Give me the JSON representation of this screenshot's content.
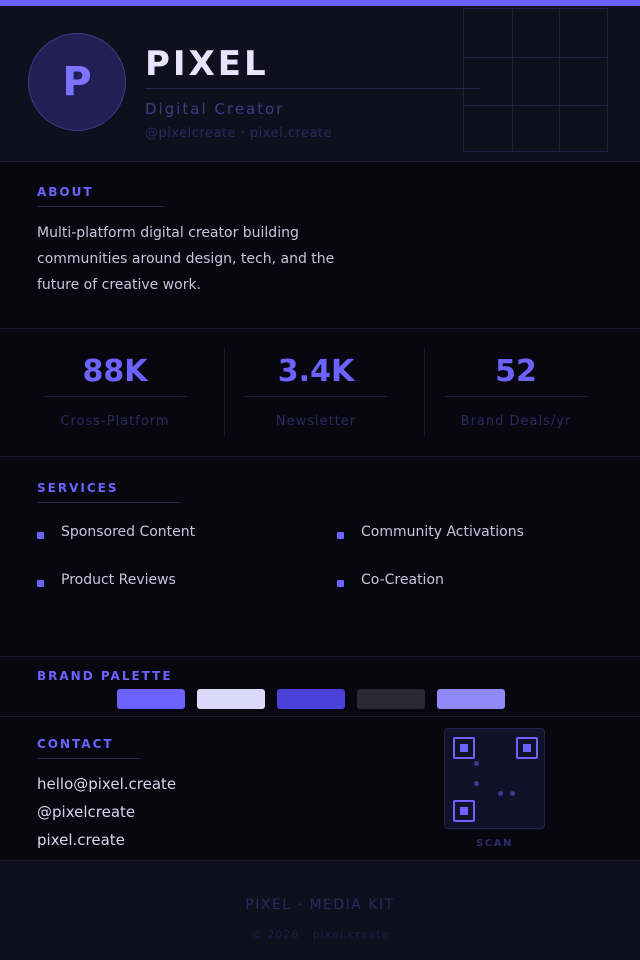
{
  "header": {
    "avatar_letter": "P",
    "name": "PIXEL",
    "role": "Digital Creator",
    "handles": "@pixelcreate · pixel.create"
  },
  "about": {
    "label": "ABOUT",
    "text": "Multi-platform digital creator building communities around design, tech, and the future of creative work."
  },
  "stats": [
    {
      "value": "88K",
      "label": "Cross-Platform"
    },
    {
      "value": "3.4K",
      "label": "Newsletter"
    },
    {
      "value": "52",
      "label": "Brand Deals/yr"
    }
  ],
  "services": {
    "label": "SERVICES",
    "items": [
      "Sponsored Content",
      "Community Activations",
      "Product Reviews",
      "Co-Creation"
    ]
  },
  "palette": {
    "label": "BRAND PALETTE",
    "colors": [
      "#6c63ff",
      "#dcd8fb",
      "#4a42d8",
      "#2a2933",
      "#8f88f7"
    ]
  },
  "contact": {
    "label": "CONTACT",
    "email": "hello@pixel.create",
    "handle": "@pixelcreate",
    "website": "pixel.create",
    "qr_label": "SCAN"
  },
  "footer": {
    "title": "PIXEL · MEDIA KIT",
    "copyright": "© 2026 · pixel.create"
  },
  "colors": {
    "accent": "#6c63ff",
    "background": "#08070f",
    "panel": "#100f1d"
  }
}
